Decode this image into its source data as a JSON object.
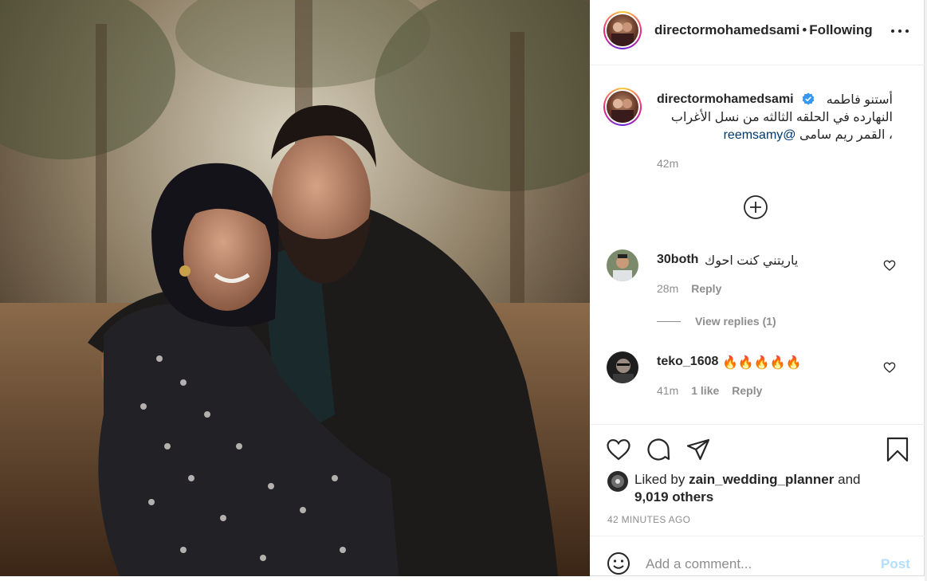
{
  "post": {
    "username": "directormohamedsami",
    "separator": "•",
    "follow_status": "Following",
    "caption_line1": "أستنو فاطمه",
    "caption_line2": "النهارده في الحلقه الثالثه من نسل الأغراب",
    "caption_line3": "، القمر ريم سامى",
    "mention": "@reemsamy",
    "caption_time": "42m"
  },
  "comments": [
    {
      "username": "30both",
      "text": "ياريتني كنت احوك",
      "time": "28m",
      "reply_label": "Reply",
      "view_replies": "View replies (1)"
    },
    {
      "username": "teko_1608",
      "text": "🔥🔥🔥🔥🔥",
      "time": "41m",
      "likes": "1 like",
      "reply_label": "Reply"
    }
  ],
  "likes": {
    "prefix": "Liked by",
    "user": "zain_wedding_planner",
    "conj": "and",
    "others": "9,019 others"
  },
  "timestamp": "42 MINUTES AGO",
  "comment_box": {
    "placeholder": "Add a comment...",
    "post_label": "Post"
  },
  "icons": {
    "header_more": "more-horizontal-icon",
    "verified": "verified-badge-icon",
    "load_more": "plus-circle-icon",
    "like": "heart-icon",
    "comment": "comment-icon",
    "share": "send-icon",
    "save": "bookmark-icon",
    "emoji": "emoji-icon"
  },
  "colors": {
    "text": "#262626",
    "muted": "#8e8e8e",
    "mention": "#00376b",
    "verified": "#3897f0",
    "post_disabled": "#b2dffc",
    "border": "#dbdbdb"
  }
}
